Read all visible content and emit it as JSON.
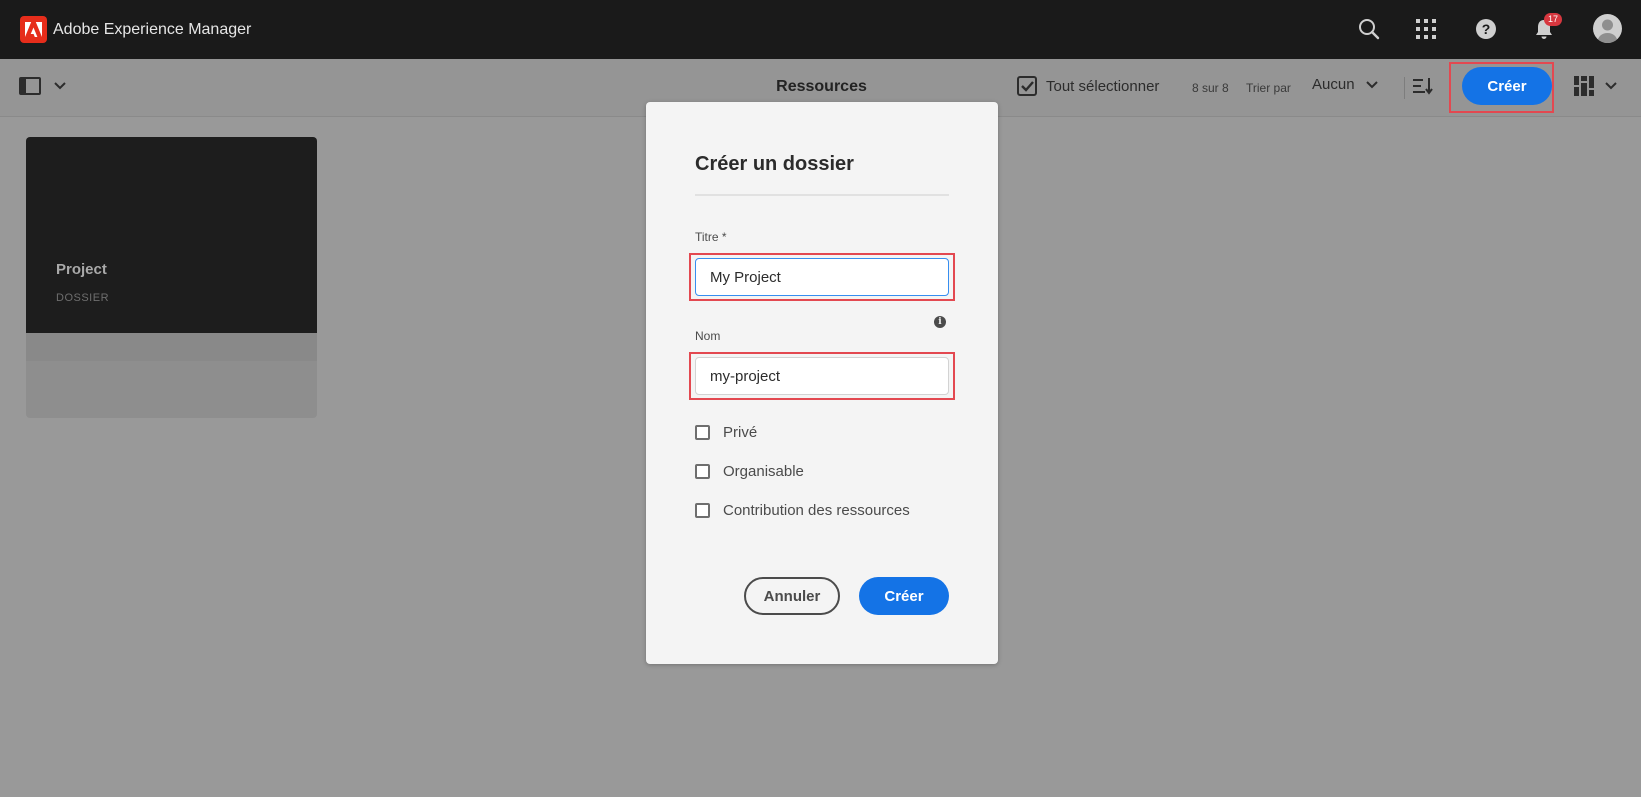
{
  "shell": {
    "app_name": "Adobe Experience Manager",
    "notification_count": "17",
    "icons": [
      "search-icon",
      "apps-grid-icon",
      "help-icon",
      "bell-icon",
      "avatar-icon"
    ]
  },
  "actionbar": {
    "title": "Ressources",
    "select_all_label": "Tout sélectionner",
    "count_text": "8 sur 8",
    "sort_label": "Trier par",
    "sort_value": "Aucun",
    "create_label": "Créer"
  },
  "card": {
    "title": "Project",
    "type": "DOSSIER"
  },
  "dialog": {
    "title": "Créer un dossier",
    "title_field_label": "Titre *",
    "title_field_value": "My Project",
    "name_field_label": "Nom",
    "name_field_value": "my-project",
    "checkboxes": [
      {
        "label": "Privé",
        "checked": false
      },
      {
        "label": "Organisable",
        "checked": false
      },
      {
        "label": "Contribution des ressources",
        "checked": false
      }
    ],
    "cancel_label": "Annuler",
    "create_label": "Créer"
  },
  "colors": {
    "accent": "#1473e6",
    "highlight": "#e34850",
    "shell_bg": "#1a1a1a",
    "brand": "#e62d1b"
  }
}
